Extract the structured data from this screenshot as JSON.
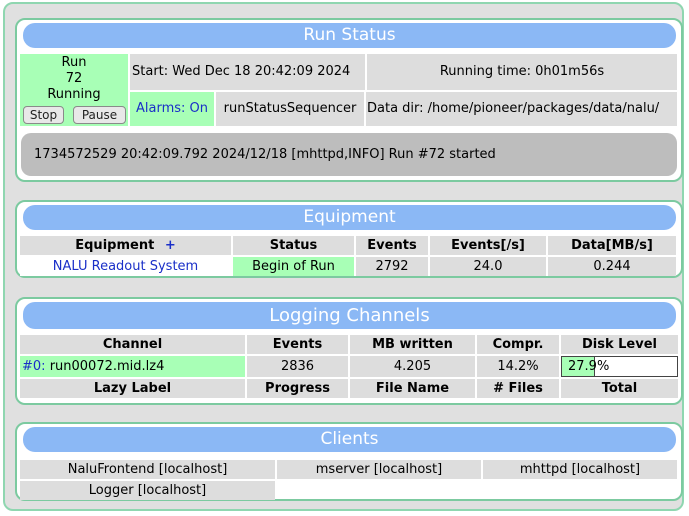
{
  "run_status": {
    "title": "Run Status",
    "run_label": "Run",
    "run_number": "72",
    "state": "Running",
    "stop_label": "Stop",
    "pause_label": "Pause",
    "start_time": "Start: Wed Dec 18 20:42:09 2024",
    "running_time": "Running time: 0h01m56s",
    "alarms": "Alarms: On",
    "sequencer": "runStatusSequencer",
    "data_dir": "Data dir: /home/pioneer/packages/data/nalu/",
    "message": "1734572529 20:42:09.792 2024/12/18 [mhttpd,INFO] Run #72 started"
  },
  "equipment": {
    "title": "Equipment",
    "headers": {
      "equipment": "Equipment",
      "add": "+",
      "status": "Status",
      "events": "Events",
      "events_rate": "Events[/s]",
      "data_rate": "Data[MB/s]"
    },
    "rows": [
      {
        "name": "NALU Readout System",
        "status": "Begin of Run",
        "events": "2792",
        "events_rate": "24.0",
        "data_rate": "0.244"
      }
    ]
  },
  "logging": {
    "title": "Logging Channels",
    "headers": {
      "channel": "Channel",
      "events": "Events",
      "mb_written": "MB written",
      "compr": "Compr.",
      "disk_level": "Disk Level"
    },
    "channels": [
      {
        "id": "#0:",
        "file": "run00072.mid.lz4",
        "events": "2836",
        "mb_written": "4.205",
        "compr": "14.2%",
        "disk_level_text": "27.9%",
        "disk_level": 0.279
      }
    ],
    "lazy_headers": {
      "label": "Lazy Label",
      "progress": "Progress",
      "file_name": "File Name",
      "files": "# Files",
      "total": "Total"
    }
  },
  "clients": {
    "title": "Clients",
    "items": [
      "NaluFrontend [localhost]",
      "mserver [localhost]",
      "mhttpd [localhost]",
      "Logger [localhost]"
    ]
  },
  "colors": {
    "title_bar": "#8bb8f5",
    "status_green": "#a8ffb6",
    "panel_border": "#7ccaa0",
    "cell_grey": "#dddddd",
    "link_blue": "#1a2fc8"
  }
}
